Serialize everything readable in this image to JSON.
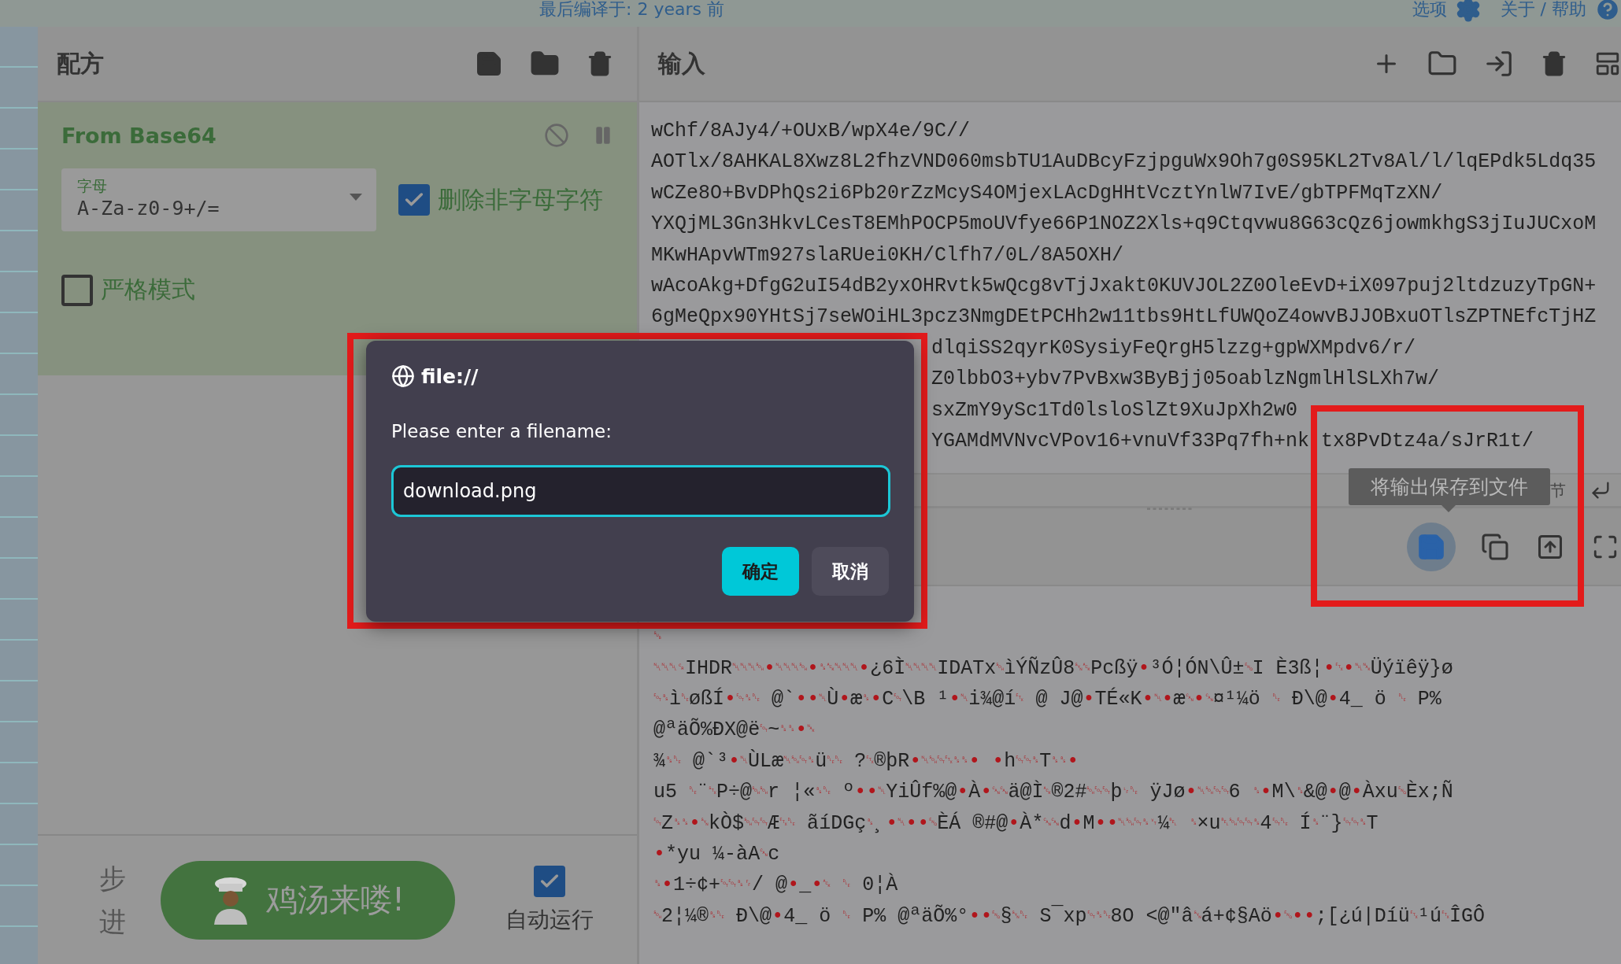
{
  "top_bar": {
    "build_info": "最后编译于: 2 years 前",
    "options": "选项",
    "help": "关于 / 帮助"
  },
  "recipe": {
    "title": "配方",
    "operation": {
      "name": "From Base64",
      "alphabet": {
        "label": "字母",
        "value": "A-Za-z0-9+/="
      },
      "options": [
        {
          "label": "删除非字母字符",
          "checked": true
        },
        {
          "label": "严格模式",
          "checked": false
        }
      ]
    },
    "controls": {
      "step": "步进",
      "bake": "鸡汤来喽!",
      "auto_bake": {
        "label": "自动运行",
        "checked": true
      }
    }
  },
  "input": {
    "title": "输入",
    "lines": [
      {
        "kind": "full",
        "text": "wChf/8AJy4/+OUxB/wpX4e/9C//"
      },
      {
        "kind": "full",
        "text": "AOTlx/8AHKAL8Xwz8L2fhzVND060msbTU1AuDBcyFzjpguWx9Oh7g0S95KL2Tv8Al/l/lqEPdk5Ldq35"
      },
      {
        "kind": "full",
        "text": "wCZe8O+BvDPhQs2i6Pb20rZzMcyS4OMjexLAcDgHHtVcztYnlW7IvE/gbTPFMqTzXN/"
      },
      {
        "kind": "full",
        "text": "YXQjML3Gn3HkvLCesT8EMhPOCP5moUVfye66P1NOZ2Xls+q9Ctqvwu8G63cQz6jowmkhgS3jIuJUCxoM"
      },
      {
        "kind": "full",
        "text": "MKwHApvWTm927slaRUei0KH/Clfh7/0L/8A5OXH/"
      },
      {
        "kind": "full",
        "text": "wAcoAkg+DfgG2uI54dB2yxOHRvtk5wQcg8vTjJxakt0KUVJOL2Z0OleEvD+iX097puj2ltdzuzyTpGN+"
      },
      {
        "kind": "full",
        "text": "6gMeQpx90YHtSj7seWOiHL3pcz3NmgDEtPCHh2w11tbs9HtLfUWQoZ4owvBJJOBxuOTlsZPTNEfcTjHZ"
      },
      {
        "kind": "partial",
        "text": "dlqiSS2qyrK0SysiyFeQrgH5lzzg+gpWXMpdv6/r/"
      },
      {
        "kind": "partial",
        "text": "Z0lbbO3+ybv7PvBxw3ByBjj05oablzNgmlHlSLXh7w/"
      },
      {
        "kind": "partial",
        "text": "sxZmY9ySc1Td0lsloSlZt9XuJpXh2w0"
      },
      {
        "kind": "split",
        "text": "YGAMdMVNvcVPov16+vnuVf33Pq7fh+nk",
        "rest": "tx8PvDtz4a/sJrR1t/"
      }
    ],
    "status": "节"
  },
  "output": {
    "tooltip": "将输出保存到文件",
    "lines": [
      "␚",
      "␀␀␀␍IHDR␀␀␀␁•␀␀␀␁•␈␆␀␀␀•¿6Ì␀␀␀␀IDATx␁ìÝÑzÛ8␖␆Pcßÿ•³Ó¦ÓN\\Û±␅I È3ß¦•␃•␀␕Üýïêÿ}ø",
      "␄␈ì␐øßÍ•␄␈␐ @`••␀Ù•æ␈•C␄\\B ¹•␀i¾@í␃ @ J@•TÉ«K•␀•æ␘•␘¤¹¼ö  ␐ Ð\\@•4_ ö  ␐ P%",
      "@ªäÕ%ÐX@ë␄~␈␈•␕",
      "¾␈␐ @`³•␀ÙLæ␀␁␄␈ü␐␐ ?␃®þR•␀␁␄␃␈␈•     •h␄␄␈T␈␈•",
      "u5  ␐¨␂P÷@␁␁r ¦«␈␐ º••␀YiÛf%@•À•␘␘ä@Ì␆®2#␁␄␄þ␊␐ ÿJø•␀␁␄␄6  ␈•M\\␞&@•@•Àxu␅Èx;Ñ",
      "␄Z␈␈•␖kÒ$␁␄␄Æ␃␐ ãíDGç␈¸•␀••␅ÈÁ ®#@•À*␘␘d•M••␀␁␄␈␋¼␇ ␈×u␇␁␄␄␈4␄␐ Í␈¨}␄␄␈T",
      "•*yu    ¼-àA␘c",
      "␈•1÷¢+␄␄␈␌/ @•_•␆  ␐ 0¦À",
      "␁2¦¼®␈␐ Ð\\@•4_ ö    ␐ P% @ªäÕ%°••␅§␖␐ S¯xp␄␈␐8O <@\"â␖á+¢§Aö•␅••;[¿ú|Díü␃¹ú␃ÎGÔ"
    ]
  },
  "dialog": {
    "origin": "file://",
    "prompt": "Please enter a filename:",
    "value": "download.png",
    "buttons": [
      {
        "label": "确定",
        "kind": "primary"
      },
      {
        "label": "取消",
        "kind": "secondary"
      }
    ]
  }
}
